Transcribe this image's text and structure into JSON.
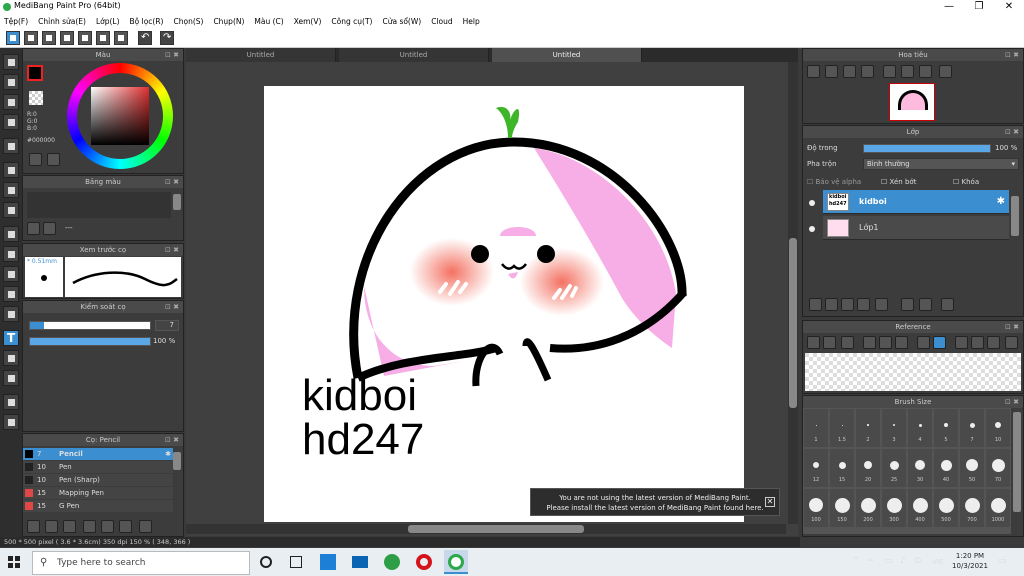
{
  "app": {
    "title": "MediBang Paint Pro (64bit)"
  },
  "menu": [
    "Tệp(F)",
    "Chỉnh sửa(E)",
    "Lớp(L)",
    "Bộ lọc(R)",
    "Chọn(S)",
    "Chụp(N)",
    "Màu (C)",
    "Xem(V)",
    "Công cụ(T)",
    "Cửa sổ(W)",
    "Cloud",
    "Help"
  ],
  "color_panel": {
    "title": "Màu",
    "r": "R:0",
    "g": "G:0",
    "b": "B:0",
    "hex": "#000000"
  },
  "palette_panel": {
    "title": "Bảng màu",
    "ellipsis": "---"
  },
  "brush_preview": {
    "title": "Xem trước cọ",
    "size": "* 0.51mm"
  },
  "brush_control": {
    "title": "Kiểm soát cọ",
    "size_value": "7",
    "opacity_value": "100 %",
    "opacity_fraction": 1.0
  },
  "brush_list": {
    "title": "Cọ: Pencil",
    "items": [
      {
        "num": "7",
        "name": "Pencil",
        "color": "#000000",
        "selected": true
      },
      {
        "num": "10",
        "name": "Pen",
        "color": "#222222"
      },
      {
        "num": "10",
        "name": "Pen (Sharp)",
        "color": "#222222"
      },
      {
        "num": "15",
        "name": "Mapping Pen",
        "color": "#e04848"
      },
      {
        "num": "15",
        "name": "G Pen",
        "color": "#e04848"
      }
    ]
  },
  "tabs": [
    "Untitled",
    "Untitled",
    "Untitled"
  ],
  "canvas_text": {
    "line1": "kidboi",
    "line2": "hd247"
  },
  "notice": {
    "line1": "You are not using the latest version of MediBang Paint.",
    "line2": "Please install the latest version of MediBang Paint found here."
  },
  "status": "500 * 500 pixel  ( 3.6 * 3.6cm)  350 dpi  150 %  ( 348, 366 )",
  "navigator": {
    "title": "Hoa tiêu"
  },
  "layer_panel": {
    "title": "Lớp",
    "opacity_label": "Độ trong",
    "opacity_value": "100 %",
    "blend_label": "Pha trộn",
    "blend_value": "Bình thường",
    "protect_alpha": "Bảo vệ alpha",
    "clipping": "Xén bớt",
    "lock": "Khóa",
    "layers": [
      {
        "name": "kidboi",
        "thumb": "kidboi hd247",
        "selected": true
      },
      {
        "name": "Lớp1",
        "selected": false
      }
    ]
  },
  "reference": {
    "title": "Reference"
  },
  "brush_size": {
    "title": "Brush Size",
    "labels": [
      "1",
      "1.5",
      "2",
      "3",
      "4",
      "5",
      "7",
      "10",
      "12",
      "15",
      "20",
      "25",
      "30",
      "40",
      "50",
      "70",
      "100",
      "150",
      "200",
      "300",
      "400",
      "500",
      "700",
      "1000"
    ]
  },
  "taskbar": {
    "search_placeholder": "Type here to search",
    "lang": "VIE",
    "time": "1:20 PM",
    "date": "10/3/2021"
  },
  "colors": {
    "accent": "#3b8ed0",
    "pink": "#f5a6e0",
    "blush": "#f36a5a",
    "stem": "#3fb52a"
  }
}
